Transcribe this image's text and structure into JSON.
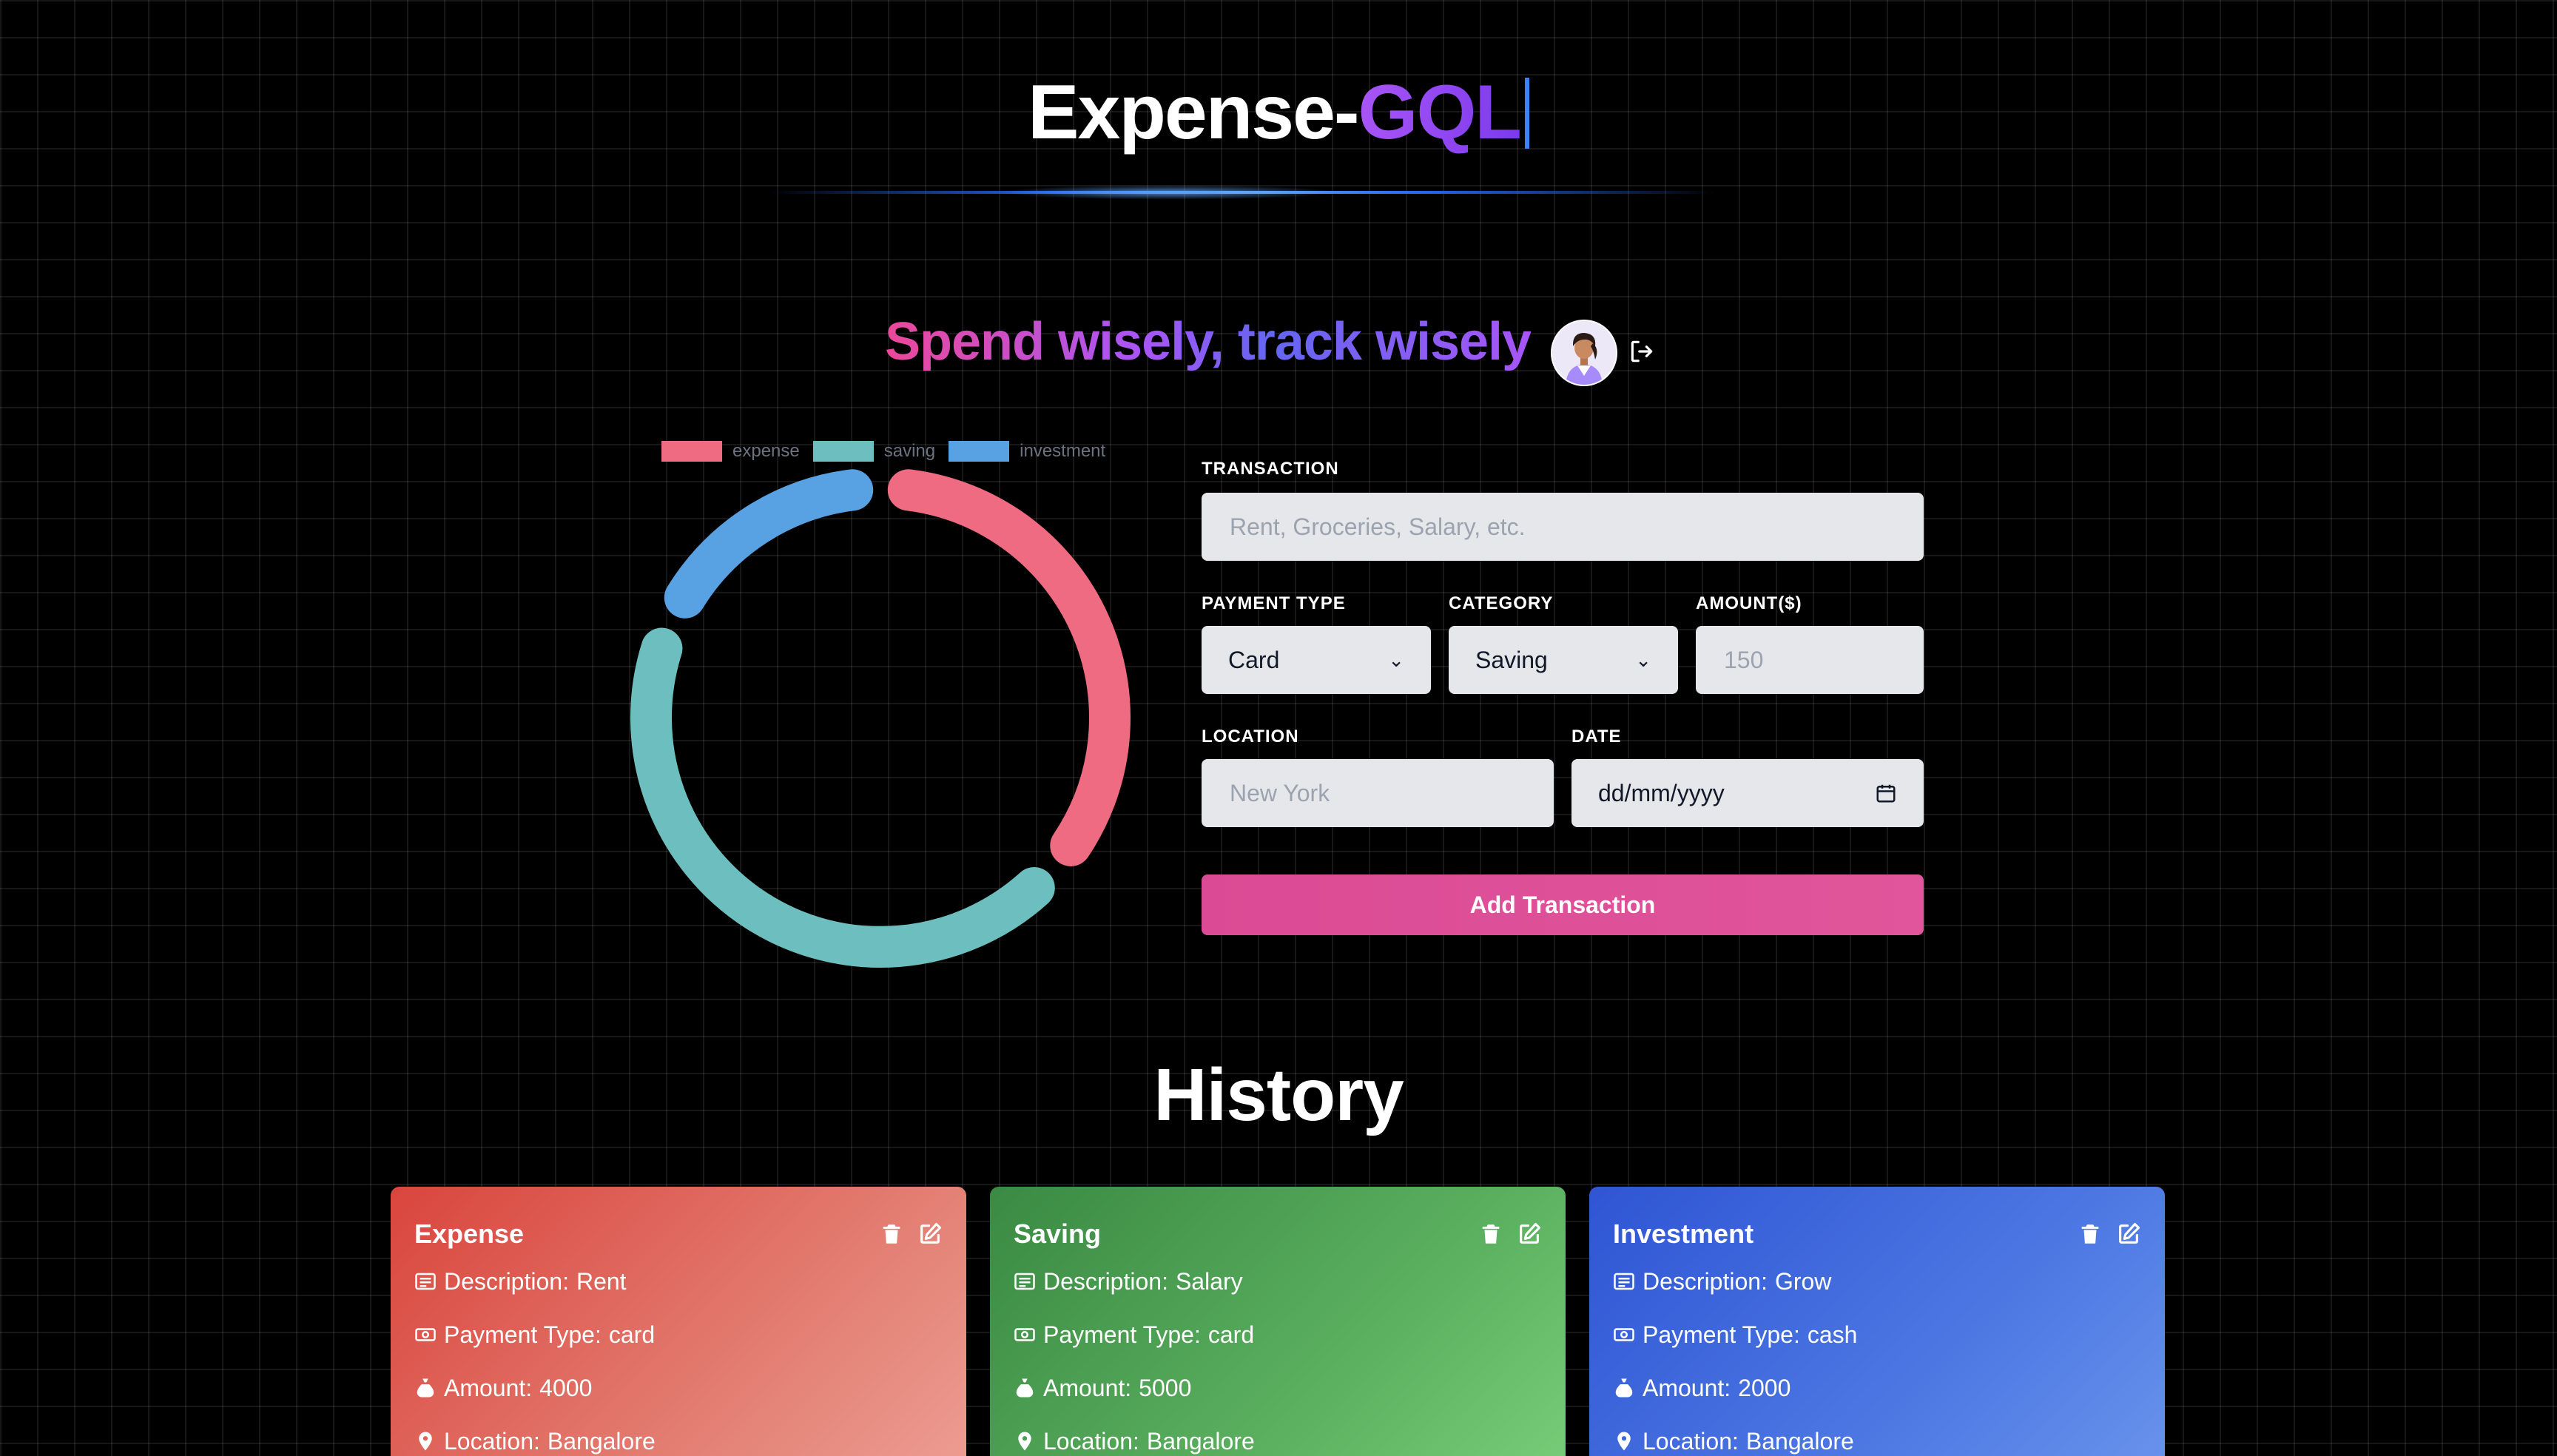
{
  "header": {
    "title_prefix": "Expense-",
    "title_accent": "GQL",
    "tagline": "Spend wisely, track wisely"
  },
  "chart_data": {
    "type": "pie",
    "categories": [
      "expense",
      "saving",
      "investment"
    ],
    "values": [
      4000,
      5000,
      2000
    ],
    "colors": [
      "#ee6b82",
      "#6dbfbf",
      "#58a2e4"
    ],
    "legend": "top"
  },
  "form": {
    "transaction_label": "TRANSACTION",
    "transaction_placeholder": "Rent, Groceries, Salary, etc.",
    "payment_type_label": "PAYMENT TYPE",
    "payment_type_value": "Card",
    "category_label": "CATEGORY",
    "category_value": "Saving",
    "amount_label": "AMOUNT($)",
    "amount_placeholder": "150",
    "location_label": "LOCATION",
    "location_placeholder": "New York",
    "date_label": "DATE",
    "date_value": "dd/mm/yyyy",
    "submit_label": "Add Transaction"
  },
  "history": {
    "title": "History",
    "description_label": "Description:",
    "payment_type_label": "Payment Type:",
    "amount_label": "Amount:",
    "location_label": "Location:",
    "cards": [
      {
        "title": "Expense",
        "description": "Rent",
        "payment_type": "card",
        "amount": "4000",
        "location": "Bangalore"
      },
      {
        "title": "Saving",
        "description": "Salary",
        "payment_type": "card",
        "amount": "5000",
        "location": "Bangalore"
      },
      {
        "title": "Investment",
        "description": "Grow",
        "payment_type": "cash",
        "amount": "2000",
        "location": "Bangalore"
      }
    ]
  }
}
